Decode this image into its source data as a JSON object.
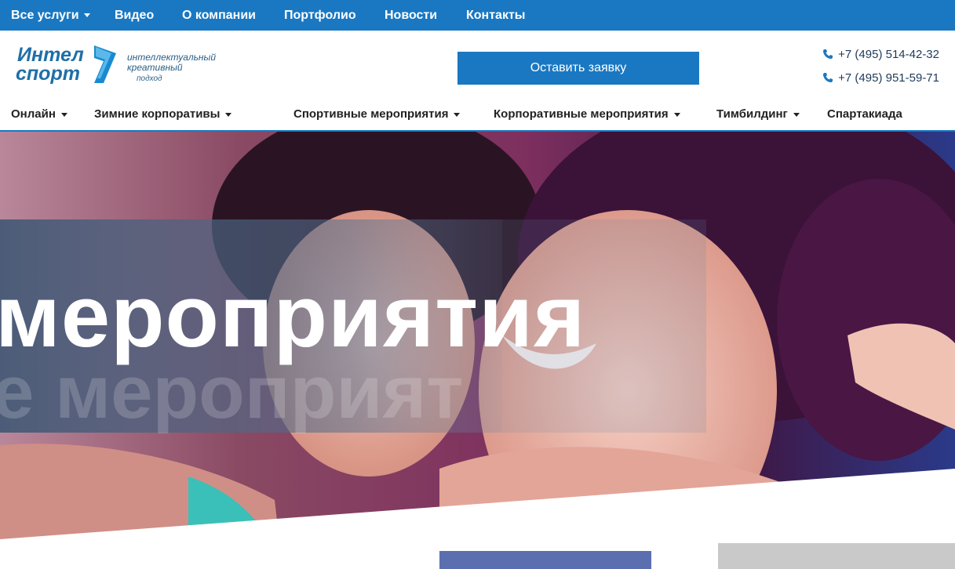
{
  "topbar": {
    "items": [
      {
        "label": "Все услуги",
        "has_dropdown": true
      },
      {
        "label": "Видео"
      },
      {
        "label": "О компании"
      },
      {
        "label": "Портфолио"
      },
      {
        "label": "Новости"
      },
      {
        "label": "Контакты"
      }
    ]
  },
  "header": {
    "logo": {
      "line1": "Интел",
      "line2": "спорт",
      "tagline1": "интеллектуальный",
      "tagline2": "креативный",
      "tagline3": "подход"
    },
    "cta_label": "Оставить заявку",
    "phones": [
      "+7 (495) 514-42-32",
      "+7 (495) 951-59-71"
    ]
  },
  "nav": {
    "items": [
      {
        "label": "Онлайн",
        "has_dropdown": true
      },
      {
        "label": "Зимние корпоративы",
        "has_dropdown": true
      },
      {
        "label": "Спортивные мероприятия",
        "has_dropdown": true
      },
      {
        "label": "Корпоративные мероприятия",
        "has_dropdown": true
      },
      {
        "label": "Тимбилдинг",
        "has_dropdown": true
      },
      {
        "label": "Спартакиада"
      }
    ]
  },
  "hero": {
    "headline": "мероприятия",
    "ghost_text": "е мероприят"
  },
  "colors": {
    "brand_blue": "#1a78c2",
    "nav_text": "#222222",
    "header_bg": "#ffffff"
  }
}
